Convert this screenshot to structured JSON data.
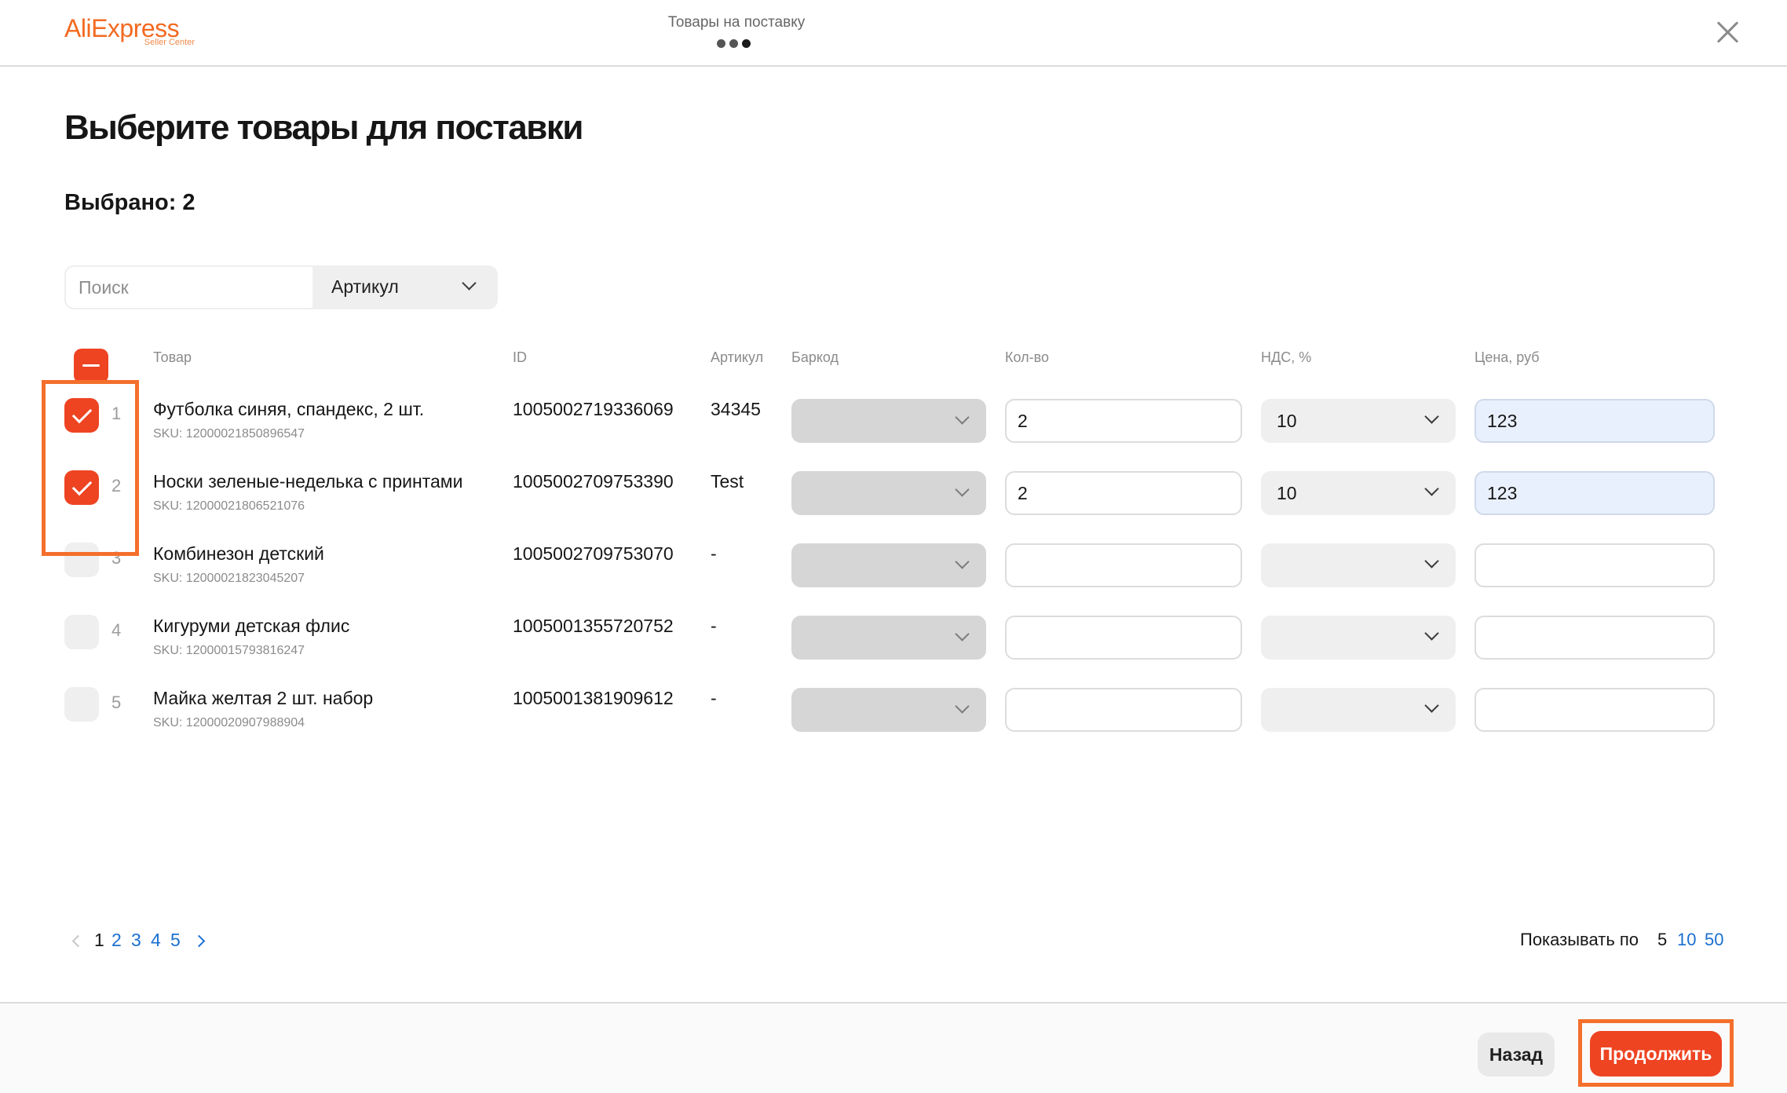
{
  "header": {
    "logo_text": "AliExpress",
    "logo_subtext": "Seller Center",
    "step_title": "Товары на поставку"
  },
  "main": {
    "title": "Выберите товары для поставки",
    "selected_label": "Выбрано: 2"
  },
  "search": {
    "placeholder": "Поиск",
    "value": "",
    "filter_selected": "Артикул"
  },
  "table": {
    "columns": {
      "product": "Товар",
      "id": "ID",
      "article": "Артикул",
      "barcode": "Баркод",
      "qty": "Кол-во",
      "vat": "НДС, %",
      "price": "Цена, руб"
    },
    "rows": [
      {
        "checked": true,
        "number": "1",
        "name": "Футболка синяя, спандекс, 2 шт.",
        "sku": "SKU: 12000021850896547",
        "id": "1005002719336069",
        "article": "34345",
        "barcode": "",
        "qty": "2",
        "vat": "10",
        "price": "123"
      },
      {
        "checked": true,
        "number": "2",
        "name": "Носки зеленые-неделька с принтами",
        "sku": "SKU: 12000021806521076",
        "id": "1005002709753390",
        "article": "Test",
        "barcode": "",
        "qty": "2",
        "vat": "10",
        "price": "123"
      },
      {
        "checked": false,
        "number": "3",
        "name": "Комбинезон детский",
        "sku": "SKU: 12000021823045207",
        "id": "1005002709753070",
        "article": "-",
        "barcode": "",
        "qty": "",
        "vat": "",
        "price": ""
      },
      {
        "checked": false,
        "number": "4",
        "name": "Кигуруми детская флис",
        "sku": "SKU: 12000015793816247",
        "id": "1005001355720752",
        "article": "-",
        "barcode": "",
        "qty": "",
        "vat": "",
        "price": ""
      },
      {
        "checked": false,
        "number": "5",
        "name": "Майка желтая 2 шт. набор",
        "sku": "SKU: 12000020907988904",
        "id": "1005001381909612",
        "article": "-",
        "barcode": "",
        "qty": "",
        "vat": "",
        "price": ""
      }
    ]
  },
  "pagination": {
    "pages": [
      "1",
      "2",
      "3",
      "4",
      "5"
    ],
    "current_page": "1",
    "per_page_label": "Показывать по",
    "per_page_options": [
      "5",
      "10",
      "50"
    ],
    "per_page_current": "5"
  },
  "footer": {
    "back_label": "Назад",
    "continue_label": "Продолжить"
  },
  "colors": {
    "accent": "#ee4422",
    "highlight_frame": "#f46f2c",
    "link": "#1a6fd0",
    "price_filled_bg": "#e9f0fd"
  },
  "icons": {
    "close": "close-icon",
    "dropdown": "chevron-down-icon",
    "checkbox_checked": "checkmark-icon",
    "checkbox_partial": "minus-icon",
    "prev": "chevron-left-icon",
    "next": "chevron-right-icon"
  }
}
